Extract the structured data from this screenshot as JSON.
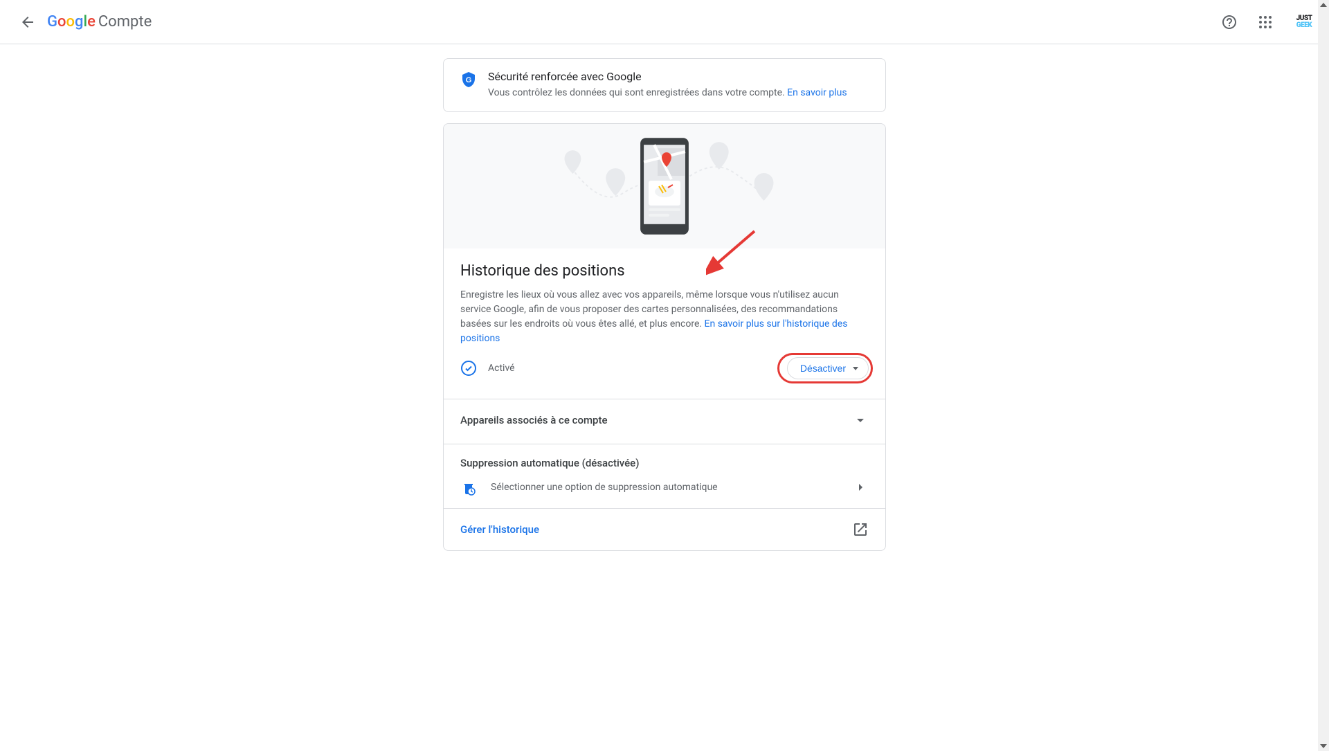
{
  "header": {
    "logo_suffix": "Compte",
    "avatar_l1": "JUST",
    "avatar_l2": "GEEK"
  },
  "security_banner": {
    "title": "Sécurité renforcée avec Google",
    "desc": "Vous contrôlez les données qui sont enregistrées dans votre compte. ",
    "link": "En savoir plus"
  },
  "main": {
    "title": "Historique des positions",
    "desc": "Enregistre les lieux où vous allez avec vos appareils, même lorsque vous n'utilisez aucun service Google, afin de vous proposer des cartes personnalisées, des recommandations basées sur les endroits où vous êtes allé, et plus encore. ",
    "desc_link": "En savoir plus sur l'historique des positions",
    "status": "Activé",
    "deactivate": "Désactiver",
    "devices_row": "Appareils associés à ce compte",
    "auto_delete_title": "Suppression automatique (désactivée)",
    "auto_delete_option": "Sélectionner une option de suppression automatique",
    "manage": "Gérer l'historique"
  }
}
